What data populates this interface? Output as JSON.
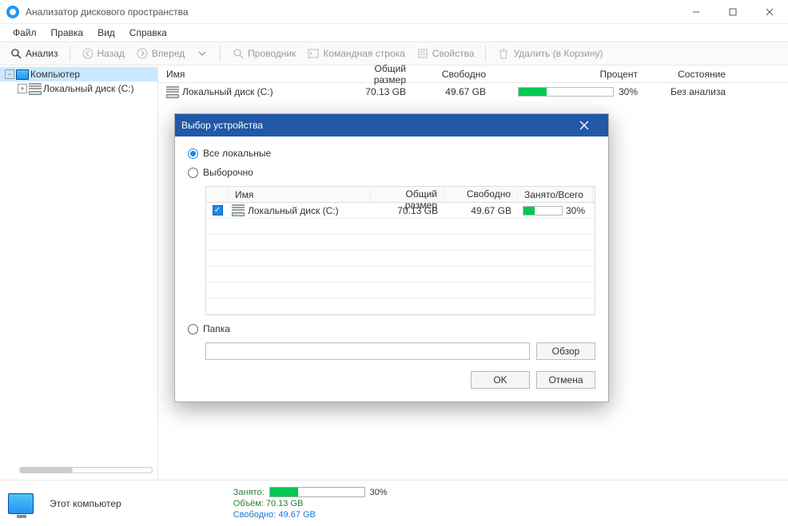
{
  "window": {
    "title": "Анализатор дискового пространства"
  },
  "menu": {
    "file": "Файл",
    "edit": "Правка",
    "view": "Вид",
    "help": "Справка"
  },
  "toolbar": {
    "analyze": "Анализ",
    "back": "Назад",
    "forward": "Вперед",
    "explorer": "Проводник",
    "cmd": "Командная строка",
    "properties": "Свойства",
    "delete": "Удалить (в Корзину)"
  },
  "tree": {
    "root": "Компьютер",
    "disk": "Локальный диск (C:)"
  },
  "table": {
    "headers": {
      "name": "Имя",
      "total": "Общий размер",
      "free": "Свободно",
      "percent": "Процент",
      "state": "Состояние"
    },
    "row": {
      "name": "Локальный диск (C:)",
      "total": "70.13 GB",
      "free": "49.67 GB",
      "percent_num": 30,
      "percent": "30%",
      "state": "Без анализа"
    }
  },
  "dialog": {
    "title": "Выбор устройства",
    "opt_all": "Все локальные",
    "opt_sel": "Выборочно",
    "opt_folder": "Папка",
    "headers": {
      "name": "Имя",
      "total": "Общий размер",
      "free": "Свободно",
      "ratio": "Занято/Всего"
    },
    "row": {
      "name": "Локальный диск (C:)",
      "total": "70.13 GB",
      "free": "49.67 GB",
      "percent_num": 30,
      "percent": "30%"
    },
    "browse": "Обзор",
    "ok": "OK",
    "cancel": "Отмена"
  },
  "status": {
    "label": "Этот компьютер",
    "used_label": "Занято:",
    "used_percent_num": 30,
    "used_percent": "30%",
    "volume": "Объём: 70.13 GB",
    "free": "Свободно: 49.67 GB"
  }
}
